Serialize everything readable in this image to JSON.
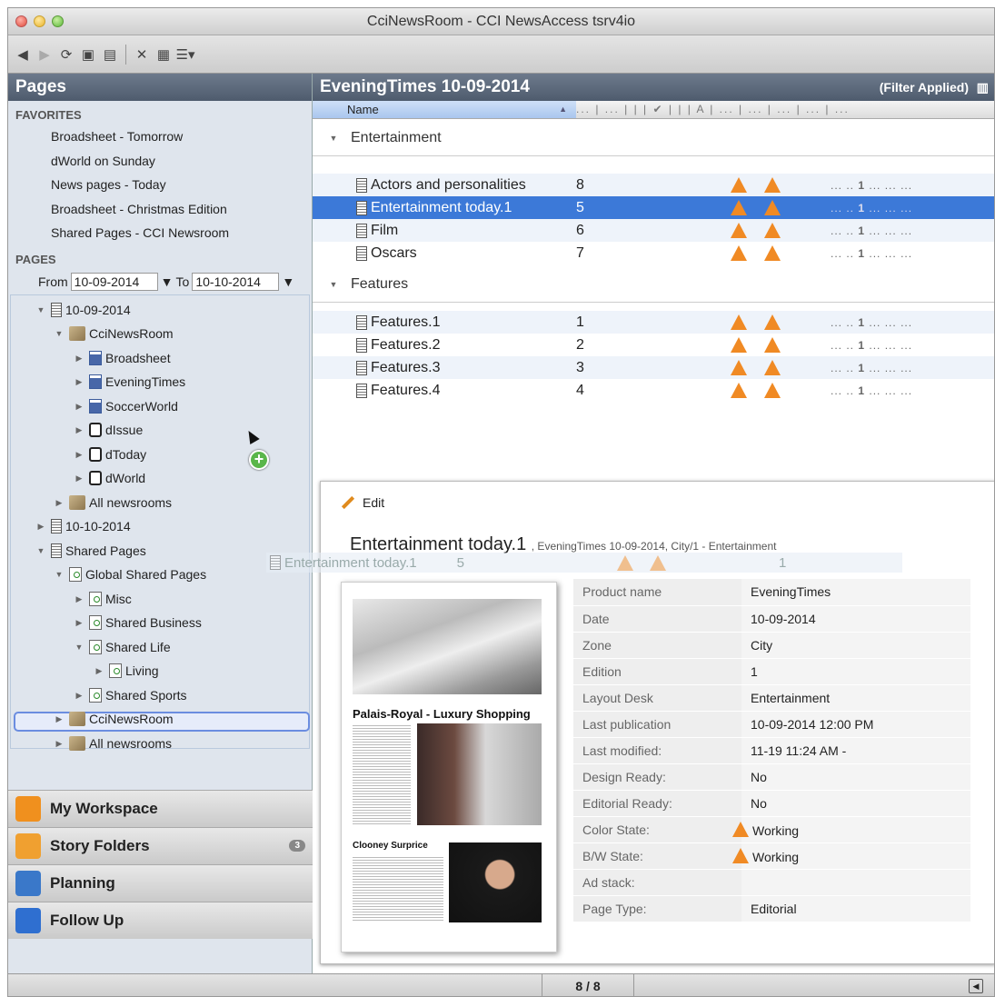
{
  "window": {
    "title": "CciNewsRoom - CCI NewsAccess tsrv4io"
  },
  "left": {
    "header": "Pages",
    "favorites_label": "FAVORITES",
    "favorites": [
      "Broadsheet - Tomorrow",
      "dWorld on Sunday",
      "News pages - Today",
      "Broadsheet - Christmas Edition",
      "Shared Pages - CCI Newsroom"
    ],
    "pages_label": "PAGES",
    "from_label": "From",
    "from_value": "10-09-2014",
    "to_label": "To",
    "to_value": "10-10-2014",
    "tree": [
      {
        "label": "10-09-2014"
      },
      {
        "label": "CciNewsRoom"
      },
      {
        "label": "Broadsheet"
      },
      {
        "label": "EveningTimes"
      },
      {
        "label": "SoccerWorld"
      },
      {
        "label": "dIssue"
      },
      {
        "label": "dToday"
      },
      {
        "label": "dWorld"
      },
      {
        "label": "All newsrooms"
      },
      {
        "label": "10-10-2014"
      },
      {
        "label": "Shared Pages"
      },
      {
        "label": "Global Shared Pages"
      },
      {
        "label": "Misc"
      },
      {
        "label": "Shared Business"
      },
      {
        "label": "Shared Life"
      },
      {
        "label": "Living"
      },
      {
        "label": "Shared Sports"
      },
      {
        "label": "CciNewsRoom"
      },
      {
        "label": "All newsrooms"
      }
    ],
    "nav": [
      {
        "label": "My Workspace",
        "color": "#f0901e"
      },
      {
        "label": "Story Folders",
        "color": "#f0a030",
        "badge": "3"
      },
      {
        "label": "Planning",
        "color": "#3a78c9"
      },
      {
        "label": "Follow Up",
        "color": "#2f6fd0"
      }
    ],
    "more": "»"
  },
  "right": {
    "header": "EveningTimes 10-09-2014",
    "filter": "(Filter Applied)",
    "col_name": "Name",
    "col_rest": "... | ... |   |   | ✔ |   |   | A | ... | ... | ... | ... | ...",
    "groups": [
      {
        "label": "Entertainment",
        "rows": [
          {
            "name": "Actors and personalities",
            "num": "8",
            "c": "1"
          },
          {
            "name": "Entertainment today.1",
            "num": "5",
            "c": "1"
          },
          {
            "name": "Film",
            "num": "6",
            "c": "1"
          },
          {
            "name": "Oscars",
            "num": "7",
            "c": "1"
          }
        ]
      },
      {
        "label": "Features",
        "rows": [
          {
            "name": "Features.1",
            "num": "1",
            "c": "1"
          },
          {
            "name": "Features.2",
            "num": "2",
            "c": "1"
          },
          {
            "name": "Features.3",
            "num": "3",
            "c": "1"
          },
          {
            "name": "Features.4",
            "num": "4",
            "c": "1"
          }
        ]
      }
    ],
    "dots_a": "...   ..",
    "dots_b": "...     ...     ..."
  },
  "detail": {
    "edit": "Edit",
    "title": "Entertainment today.1",
    "subtitle": ", EveningTimes 10-09-2014, City/1 - Entertainment",
    "ghost_name": "Entertainment today.1",
    "ghost_num": "5",
    "ghost_c": "1",
    "thumb_title1": "Palais-Royal - Luxury Shopping",
    "thumb_title2": "Clooney Surprice",
    "props": [
      {
        "k": "Product name",
        "v": "EveningTimes"
      },
      {
        "k": "Date",
        "v": "10-09-2014"
      },
      {
        "k": "Zone",
        "v": "City"
      },
      {
        "k": "Edition",
        "v": "1"
      },
      {
        "k": "Layout Desk",
        "v": "Entertainment"
      },
      {
        "k": "Last publication",
        "v": "10-09-2014 12:00 PM"
      },
      {
        "k": "Last modified:",
        "v": "11-19 11:24 AM -"
      },
      {
        "k": "Design Ready:",
        "v": "No"
      },
      {
        "k": "Editorial Ready:",
        "v": "No"
      },
      {
        "k": "Color State:",
        "v": "Working"
      },
      {
        "k": "B/W State:",
        "v": "Working"
      },
      {
        "k": "Ad stack:",
        "v": ""
      },
      {
        "k": "Page Type:",
        "v": "Editorial"
      }
    ]
  },
  "status": {
    "page": "8 / 8"
  }
}
